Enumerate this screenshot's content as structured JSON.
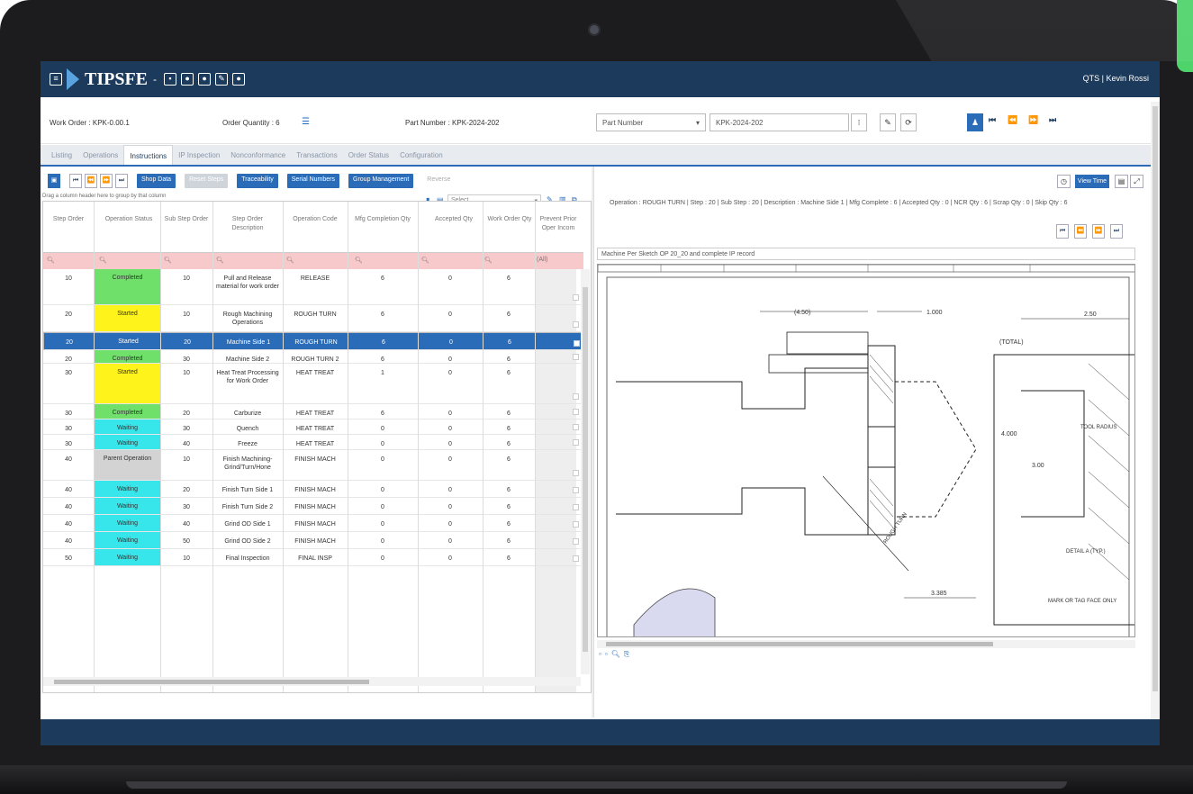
{
  "app": {
    "title": "TIPSFE",
    "user": "QTS | Kevin Rossi"
  },
  "header": {
    "work_order": "Work Order : KPK-0.00.1",
    "order_qty": "Order Quantity : 6",
    "part_number": "Part Number : KPK-2024-202",
    "part_select": "Part Number",
    "part_value": "KPK-2024-202"
  },
  "tabs": [
    "Listing",
    "Operations",
    "Instructions",
    "IP Inspection",
    "Nonconformance",
    "Transactions",
    "Order Status",
    "Configuration"
  ],
  "active_tab": 2,
  "toolbar": {
    "shop_data": "Shop Data",
    "reset_steps": "Reset Steps",
    "traceability": "Traceability",
    "serial_numbers": "Serial Numbers",
    "group_management": "Group Management",
    "reverse": "Reverse"
  },
  "group_hint": "Drag a column header here to group by that column",
  "grid_select": "Select...",
  "columns": [
    "Step Order",
    "Operation Status",
    "Sub Step Order",
    "Step Order Description",
    "Operation Code",
    "Mfg Completion Qty",
    "Accepted Qty",
    "Work Order Qty",
    "Prevent Prior Oper Incom"
  ],
  "filter_all": "(All)",
  "rows": [
    {
      "step": "10",
      "status": "Completed",
      "sub": "10",
      "desc": "Pull and Release material for work order",
      "code": "RELEASE",
      "mfg": "6",
      "acc": "0",
      "woq": "6",
      "color": "#6fe06a",
      "h": 40
    },
    {
      "step": "20",
      "status": "Started",
      "sub": "10",
      "desc": "Rough Machining Operations",
      "code": "ROUGH TURN",
      "mfg": "6",
      "acc": "0",
      "woq": "6",
      "color": "#fff31c",
      "h": 30
    },
    {
      "step": "20",
      "status": "Started",
      "sub": "20",
      "desc": "Machine Side 1",
      "code": "ROUGH TURN",
      "mfg": "6",
      "acc": "0",
      "woq": "6",
      "color": "#fff31c",
      "h": 20,
      "selected": true
    },
    {
      "step": "20",
      "status": "Completed",
      "sub": "30",
      "desc": "Machine Side 2",
      "code": "ROUGH TURN 2",
      "mfg": "6",
      "acc": "0",
      "woq": "6",
      "color": "#6fe06a",
      "h": 15
    },
    {
      "step": "30",
      "status": "Started",
      "sub": "10",
      "desc": "Heat Treat Processing for Work Order",
      "code": "HEAT TREAT",
      "mfg": "1",
      "acc": "0",
      "woq": "6",
      "color": "#fff31c",
      "h": 45
    },
    {
      "step": "30",
      "status": "Completed",
      "sub": "20",
      "desc": "Carburize",
      "code": "HEAT TREAT",
      "mfg": "6",
      "acc": "0",
      "woq": "6",
      "color": "#6fe06a",
      "h": 17
    },
    {
      "step": "30",
      "status": "Waiting",
      "sub": "30",
      "desc": "Quench",
      "code": "HEAT TREAT",
      "mfg": "0",
      "acc": "0",
      "woq": "6",
      "color": "#37e6ea",
      "h": 17
    },
    {
      "step": "30",
      "status": "Waiting",
      "sub": "40",
      "desc": "Freeze",
      "code": "HEAT TREAT",
      "mfg": "0",
      "acc": "0",
      "woq": "6",
      "color": "#37e6ea",
      "h": 17
    },
    {
      "step": "40",
      "status": "Parent Operation",
      "sub": "10",
      "desc": "Finish Machining-Grind/Turn/Hone",
      "code": "FINISH MACH",
      "mfg": "0",
      "acc": "0",
      "woq": "6",
      "color": "#d3d3d3",
      "h": 34
    },
    {
      "step": "40",
      "status": "Waiting",
      "sub": "20",
      "desc": "Finish Turn Side 1",
      "code": "FINISH MACH",
      "mfg": "0",
      "acc": "0",
      "woq": "6",
      "color": "#37e6ea",
      "h": 19
    },
    {
      "step": "40",
      "status": "Waiting",
      "sub": "30",
      "desc": "Finish Turn Side 2",
      "code": "FINISH MACH",
      "mfg": "0",
      "acc": "0",
      "woq": "6",
      "color": "#37e6ea",
      "h": 19
    },
    {
      "step": "40",
      "status": "Waiting",
      "sub": "40",
      "desc": "Grind OD Side 1",
      "code": "FINISH MACH",
      "mfg": "0",
      "acc": "0",
      "woq": "6",
      "color": "#37e6ea",
      "h": 19
    },
    {
      "step": "40",
      "status": "Waiting",
      "sub": "50",
      "desc": "Grind OD Side 2",
      "code": "FINISH MACH",
      "mfg": "0",
      "acc": "0",
      "woq": "6",
      "color": "#37e6ea",
      "h": 19
    },
    {
      "step": "50",
      "status": "Waiting",
      "sub": "10",
      "desc": "Final Inspection",
      "code": "FINAL INSP",
      "mfg": "0",
      "acc": "0",
      "woq": "6",
      "color": "#37e6ea",
      "h": 19
    }
  ],
  "right": {
    "view_time": "View Time",
    "op_info": "Operation : ROUGH TURN | Step : 20 | Sub Step : 20 | Description : Machine Side 1 | Mfg Complete : 6 | Accepted Qty : 0 | NCR Qty : 6 | Scrap Qty : 0 | Skip Qty : 6",
    "drawing_title": "Machine Per Sketch OP 20_20 and complete IP record",
    "dims": {
      "d1": "(4.50)",
      "d2": "1.000",
      "d3": "2.50",
      "d4": "(TOTAL)",
      "d5": "4.000",
      "d6": "3.00",
      "d7": "DETAIL A (TYP.)",
      "d8": "MARK OR TAG FACE ONLY",
      "d9": "3.385",
      "d10": "ROUGH TURN",
      "d11": "TOOL RADIUS"
    }
  }
}
